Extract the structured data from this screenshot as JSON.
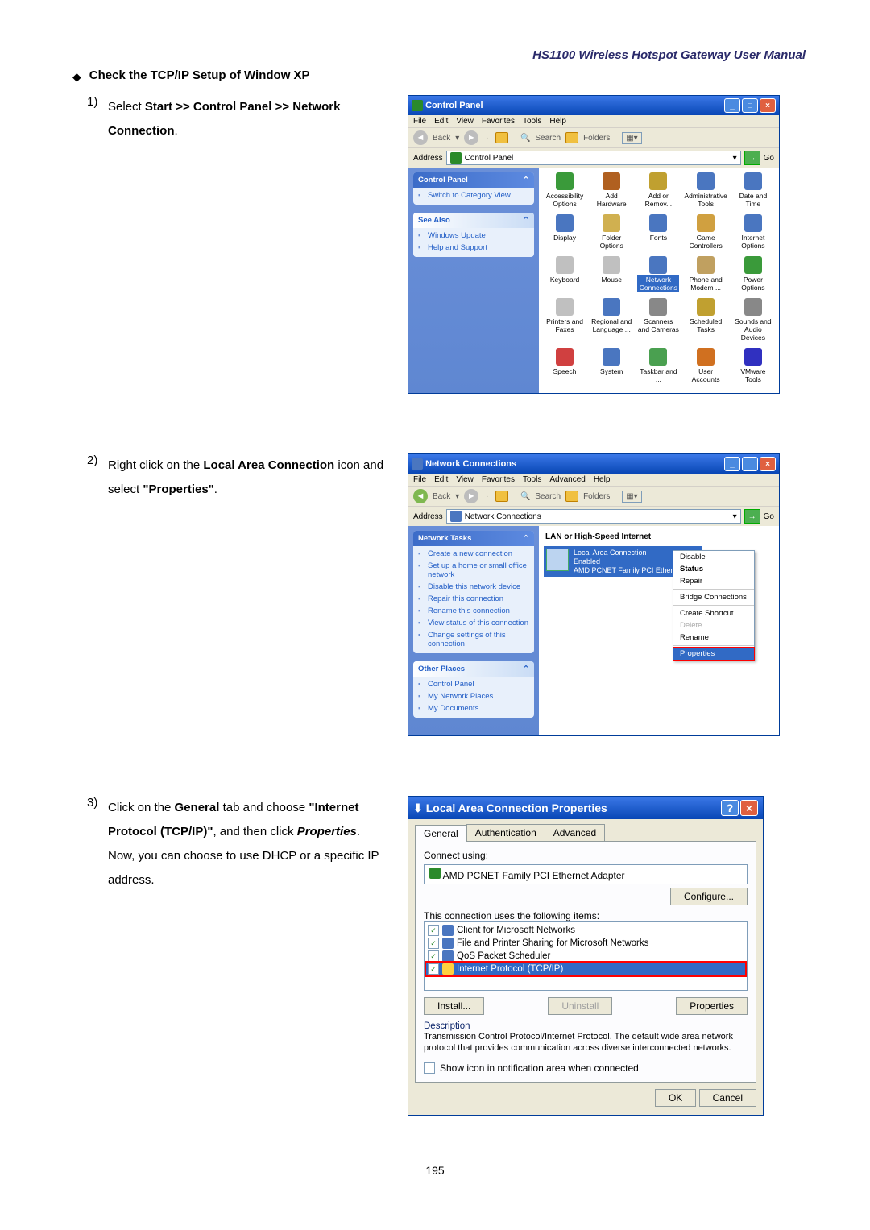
{
  "header": {
    "title": "HS1100 Wireless Hotspot Gateway User Manual"
  },
  "section": {
    "check_heading": "Check the TCP/IP Setup of Window XP"
  },
  "steps": {
    "s1": {
      "num": "1)",
      "pre": "Select ",
      "bold": "Start >> Control Panel >> Network Connection",
      "post": "."
    },
    "s2": {
      "num": "2)",
      "pre": "Right click on the ",
      "bold": "Local Area Connection",
      "mid": " icon and select ",
      "bold2": "\"Properties\"",
      "post": "."
    },
    "s3": {
      "num": "3)",
      "line1_pre": "Click on the ",
      "line1_b1": "General",
      "line1_mid": " tab and choose ",
      "line1_b2": "\"Internet Protocol (TCP/IP)\"",
      "line1_post": ", and then click ",
      "line1_i": "Properties",
      "line1_end": ".",
      "line2": "Now, you can choose to use DHCP or a specific IP address."
    }
  },
  "page_number": "195",
  "win_cp": {
    "title": "Control Panel",
    "menu": [
      "File",
      "Edit",
      "View",
      "Favorites",
      "Tools",
      "Help"
    ],
    "tb_back": "Back",
    "tb_search": "Search",
    "tb_folders": "Folders",
    "addr_label": "Address",
    "addr_value": "Control Panel",
    "go": "Go",
    "side_cp_title": "Control Panel",
    "side_switch": "Switch to Category View",
    "side_see_also": "See Also",
    "side_wu": "Windows Update",
    "side_help": "Help and Support",
    "icons": [
      {
        "l": "Accessibility Options",
        "c": "#3a9a3a"
      },
      {
        "l": "Add Hardware",
        "c": "#b06020"
      },
      {
        "l": "Add or Remov...",
        "c": "#c0a030"
      },
      {
        "l": "Administrative Tools",
        "c": "#4a76c0"
      },
      {
        "l": "Date and Time",
        "c": "#4a76c0"
      },
      {
        "l": "Display",
        "c": "#4a76c0"
      },
      {
        "l": "Folder Options",
        "c": "#d0b050"
      },
      {
        "l": "Fonts",
        "c": "#4a76c0"
      },
      {
        "l": "Game Controllers",
        "c": "#d0a040"
      },
      {
        "l": "Internet Options",
        "c": "#4a76c0"
      },
      {
        "l": "Keyboard",
        "c": "#c0c0c0"
      },
      {
        "l": "Mouse",
        "c": "#c0c0c0"
      },
      {
        "l": "Network Connections",
        "c": "#4a76c0",
        "sel": true
      },
      {
        "l": "Phone and Modem ...",
        "c": "#c0a060"
      },
      {
        "l": "Power Options",
        "c": "#3a9a3a"
      },
      {
        "l": "Printers and Faxes",
        "c": "#c0c0c0"
      },
      {
        "l": "Regional and Language ...",
        "c": "#4a76c0"
      },
      {
        "l": "Scanners and Cameras",
        "c": "#888"
      },
      {
        "l": "Scheduled Tasks",
        "c": "#c0a030"
      },
      {
        "l": "Sounds and Audio Devices",
        "c": "#888"
      },
      {
        "l": "Speech",
        "c": "#d04040"
      },
      {
        "l": "System",
        "c": "#4a76c0"
      },
      {
        "l": "Taskbar and ...",
        "c": "#4aa050"
      },
      {
        "l": "User Accounts",
        "c": "#d07020"
      },
      {
        "l": "VMware Tools",
        "c": "#3030c0"
      }
    ]
  },
  "win_nc": {
    "title": "Network Connections",
    "menu": [
      "File",
      "Edit",
      "View",
      "Favorites",
      "Tools",
      "Advanced",
      "Help"
    ],
    "tb_back": "Back",
    "tb_search": "Search",
    "tb_folders": "Folders",
    "addr_label": "Address",
    "addr_value": "Network Connections",
    "go": "Go",
    "group": "LAN or High-Speed Internet",
    "conn_name": "Local Area Connection",
    "conn_status": "Enabled",
    "conn_dev": "AMD PCNET Family PCI Ethern...",
    "side_nt": "Network Tasks",
    "nt_items": [
      "Create a new connection",
      "Set up a home or small office network",
      "Disable this network device",
      "Repair this connection",
      "Rename this connection",
      "View status of this connection",
      "Change settings of this connection"
    ],
    "side_op": "Other Places",
    "op_items": [
      "Control Panel",
      "My Network Places",
      "My Documents"
    ],
    "ctx": [
      "Disable",
      "Status",
      "Repair",
      "Bridge Connections",
      "Create Shortcut",
      "Delete",
      "Rename",
      "Properties"
    ]
  },
  "dlg_lac": {
    "title": "Local Area Connection Properties",
    "tabs": [
      "General",
      "Authentication",
      "Advanced"
    ],
    "connect_using": "Connect using:",
    "adapter": "AMD PCNET Family PCI Ethernet Adapter",
    "configure": "Configure...",
    "uses": "This connection uses the following items:",
    "items": [
      {
        "l": "Client for Microsoft Networks",
        "chk": true
      },
      {
        "l": "File and Printer Sharing for Microsoft Networks",
        "chk": true
      },
      {
        "l": "QoS Packet Scheduler",
        "chk": true
      },
      {
        "l": "Internet Protocol (TCP/IP)",
        "chk": true,
        "sel": true
      }
    ],
    "install": "Install...",
    "uninstall": "Uninstall",
    "properties": "Properties",
    "desc_hd": "Description",
    "desc": "Transmission Control Protocol/Internet Protocol. The default wide area network protocol that provides communication across diverse interconnected networks.",
    "show_icon": "Show icon in notification area when connected",
    "ok": "OK",
    "cancel": "Cancel"
  }
}
